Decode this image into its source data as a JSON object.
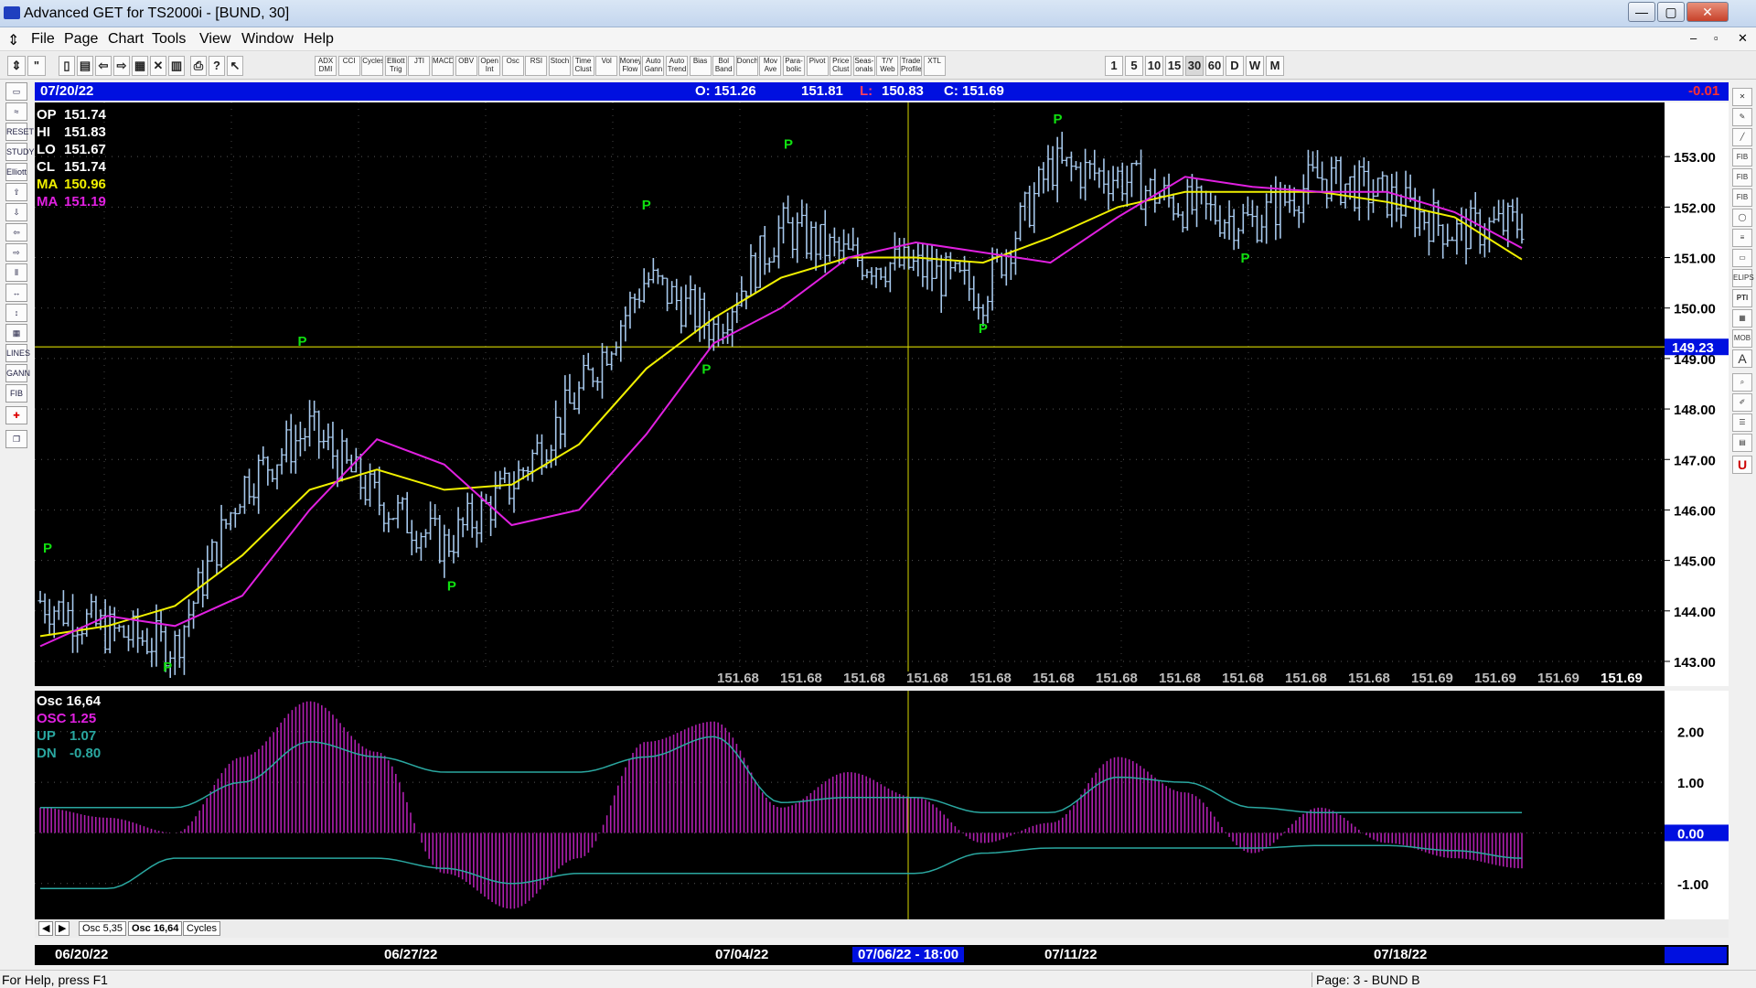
{
  "window": {
    "title": "Advanced GET for TS2000i - [BUND, 30]"
  },
  "menu": [
    "File",
    "Page",
    "Chart",
    "Tools",
    "View",
    "Window",
    "Help"
  ],
  "toolbar": {
    "indicators": [
      "ADX DMI",
      "CCI",
      "Cycles",
      "Elliott Trig",
      "JTI",
      "MACD",
      "OBV",
      "Open Int",
      "Osc",
      "RSI",
      "Stoch",
      "Time Clust",
      "Vol",
      "Money Flow",
      "Auto Gann",
      "Auto Trend",
      "Bias",
      "Bol Band",
      "Donch",
      "Mov Ave",
      "Para-bolic",
      "Pivot",
      "Price Clust",
      "Seas-onals",
      "T/Y Web",
      "Trade Profile",
      "XTL"
    ],
    "intervals": [
      "1",
      "5",
      "10",
      "15",
      "30",
      "60",
      "D",
      "W",
      "M"
    ]
  },
  "left_tools": [
    "RESET",
    "STUDY",
    "Elliott",
    "LINES",
    "GANN",
    "FIB"
  ],
  "right_tools": [
    "FIB RET",
    "FIB EXT",
    "FIB TIME",
    "ELIPS",
    "PTI",
    "MOB",
    "A",
    "U"
  ],
  "info_bar": {
    "date": "07/20/22",
    "open": "O: 151.26",
    "high": "151.81",
    "low_label": "L:",
    "low": "150.83",
    "close": "C: 151.69",
    "change": "-0.01"
  },
  "legend": {
    "op_label": "OP",
    "op": "151.74",
    "hi_label": "HI",
    "hi": "151.83",
    "lo_label": "LO",
    "lo": "151.67",
    "cl_label": "CL",
    "cl": "151.74",
    "ma1_label": "MA",
    "ma1": "150.96",
    "ma2_label": "MA",
    "ma2": "151.19"
  },
  "colors": {
    "bars": "#a6c8ec",
    "ma1": "#f0f000",
    "ma2": "#e020e0",
    "pivot": "#10e010",
    "hist": "#b020b0",
    "band": "#2aa7a0",
    "hline": "#d8d800",
    "hline_label": "#0010e0"
  },
  "price_axis": {
    "ticks": [
      "153.00",
      "152.00",
      "151.00",
      "150.00",
      "149.00",
      "148.00",
      "147.00",
      "146.00",
      "145.00",
      "144.00",
      "143.00"
    ],
    "hline": "149.23"
  },
  "pivot_label": "P",
  "pivots": [
    {
      "date": "06/20/22 14:00",
      "value": 144.9,
      "side": "high"
    },
    {
      "date": "06/22/22 10:00",
      "value": 143.2,
      "side": "low"
    },
    {
      "date": "06/24/22 10:00",
      "value": 149.0,
      "side": "high"
    },
    {
      "date": "06/28/22 14:00",
      "value": 144.8,
      "side": "low"
    },
    {
      "date": "07/01/22 12:00",
      "value": 151.7,
      "side": "high"
    },
    {
      "date": "07/04/22 10:00",
      "value": 149.1,
      "side": "low"
    },
    {
      "date": "07/05/22 14:00",
      "value": 152.9,
      "side": "high"
    },
    {
      "date": "07/08/22 12:00",
      "value": 149.9,
      "side": "low"
    },
    {
      "date": "07/11/22 14:00",
      "value": 153.4,
      "side": "high"
    },
    {
      "date": "07/14/22 10:00",
      "value": 151.3,
      "side": "low"
    }
  ],
  "price_readouts": [
    "151.68",
    "151.68",
    "151.68",
    "151.68",
    "151.68",
    "151.68",
    "151.68",
    "151.68",
    "151.68",
    "151.68",
    "151.68",
    "151.69",
    "151.69",
    "151.69"
  ],
  "price_readout_last": "151.69",
  "osc_legend": {
    "title": "Osc 16,64",
    "osc_label": "OSC",
    "osc": "1.25",
    "up_label": "UP",
    "up": "1.07",
    "dn_label": "DN",
    "dn": "-0.80"
  },
  "osc_axis": {
    "ticks": [
      "2.00",
      "1.00",
      "0.00",
      "-1.00"
    ],
    "zero_label": "0.00"
  },
  "tabs": [
    "Osc 5,35",
    "Osc 16,64",
    "Cycles"
  ],
  "date_axis": [
    "06/20/22",
    "06/27/22",
    "07/04/22",
    "07/11/22",
    "07/18/22"
  ],
  "cursor_date": "07/06/22 - 18:00",
  "status": {
    "help": "For Help, press F1",
    "page": "Page: 3 - BUND B"
  },
  "chart_data": {
    "type": "line",
    "x": [
      "06/20/22",
      "06/21/22",
      "06/22/22",
      "06/23/22",
      "06/24/22",
      "06/27/22",
      "06/28/22",
      "06/29/22",
      "06/30/22",
      "07/01/22",
      "07/04/22",
      "07/05/22",
      "07/06/22",
      "07/07/22",
      "07/08/22",
      "07/11/22",
      "07/12/22",
      "07/13/22",
      "07/14/22",
      "07/15/22",
      "07/18/22",
      "07/19/22",
      "07/20/22"
    ],
    "series": [
      {
        "name": "close",
        "values": [
          144.2,
          143.6,
          143.3,
          146.5,
          147.6,
          146.2,
          145.3,
          146.5,
          148.3,
          150.6,
          149.6,
          151.6,
          151.0,
          150.8,
          150.3,
          152.8,
          152.6,
          152.0,
          151.7,
          152.6,
          152.2,
          151.5,
          151.69
        ]
      },
      {
        "name": "MA",
        "values": [
          143.5,
          143.7,
          144.1,
          145.1,
          146.4,
          146.8,
          146.4,
          146.5,
          147.3,
          148.8,
          149.8,
          150.6,
          151.0,
          151.0,
          150.9,
          151.4,
          152.0,
          152.3,
          152.3,
          152.3,
          152.1,
          151.8,
          150.96
        ]
      },
      {
        "name": "MA",
        "values": [
          143.3,
          143.9,
          143.7,
          144.3,
          146.0,
          147.4,
          146.9,
          145.7,
          146.0,
          147.5,
          149.3,
          150.0,
          151.0,
          151.3,
          151.1,
          150.9,
          151.8,
          152.6,
          152.4,
          152.3,
          152.3,
          151.9,
          151.19
        ]
      }
    ],
    "osc": {
      "x": [
        "06/20/22",
        "06/21/22",
        "06/22/22",
        "06/23/22",
        "06/24/22",
        "06/27/22",
        "06/28/22",
        "06/29/22",
        "06/30/22",
        "07/01/22",
        "07/04/22",
        "07/05/22",
        "07/06/22",
        "07/07/22",
        "07/08/22",
        "07/11/22",
        "07/12/22",
        "07/13/22",
        "07/14/22",
        "07/15/22",
        "07/18/22",
        "07/19/22",
        "07/20/22"
      ],
      "osc": [
        0.5,
        0.3,
        0.0,
        1.5,
        2.6,
        1.6,
        -0.8,
        -1.5,
        -0.5,
        1.8,
        2.2,
        0.5,
        1.2,
        0.7,
        -0.2,
        0.2,
        1.5,
        0.8,
        -0.4,
        0.5,
        -0.2,
        -0.5,
        -0.7
      ],
      "up": [
        0.5,
        0.5,
        0.5,
        1.0,
        1.8,
        1.5,
        1.2,
        1.2,
        1.2,
        1.5,
        1.9,
        0.6,
        0.7,
        0.7,
        0.4,
        0.4,
        1.1,
        1.0,
        0.5,
        0.4,
        0.4,
        0.4,
        0.4
      ],
      "dn": [
        -1.1,
        -1.1,
        -0.5,
        -0.5,
        -0.5,
        -0.5,
        -0.7,
        -1.0,
        -0.8,
        -0.8,
        -0.8,
        -0.8,
        -0.8,
        -0.8,
        -0.4,
        -0.3,
        -0.3,
        -0.3,
        -0.3,
        -0.25,
        -0.25,
        -0.35,
        -0.5
      ],
      "ylim": [
        -1.6,
        2.7
      ]
    },
    "ylim": [
      142.8,
      154.0
    ]
  }
}
